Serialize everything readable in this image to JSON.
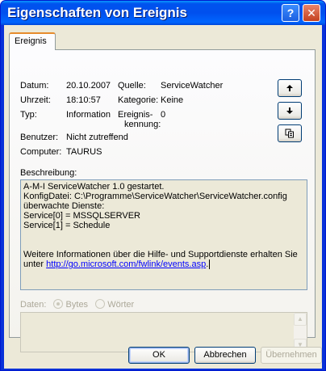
{
  "window": {
    "title": "Eigenschaften von Ereignis",
    "help_label": "?",
    "close_label": "✕"
  },
  "tab": {
    "label": "Ereignis"
  },
  "fields": {
    "datum_label": "Datum:",
    "datum_value": "20.10.2007",
    "quelle_label": "Quelle:",
    "quelle_value": "ServiceWatcher",
    "uhrzeit_label": "Uhrzeit:",
    "uhrzeit_value": "18:10:57",
    "kategorie_label": "Kategorie:",
    "kategorie_value": "Keine",
    "typ_label": "Typ:",
    "typ_value": "Information",
    "ereigniskennung_label_1": "Ereignis-",
    "ereigniskennung_label_2": "kennung:",
    "ereigniskennung_value": "0",
    "benutzer_label": "Benutzer:",
    "benutzer_value": "Nicht zutreffend",
    "computer_label": "Computer:",
    "computer_value": "TAURUS"
  },
  "side_buttons": {
    "up_icon": "arrow-up-icon",
    "down_icon": "arrow-down-icon",
    "copy_icon": "copy-icon"
  },
  "description": {
    "label": "Beschreibung:",
    "lines": [
      "A-M-I ServiceWatcher 1.0 gestartet.",
      "KonfigDatei: C:\\Programme\\ServiceWatcher\\ServiceWatcher.config",
      "überwachte Dienste:",
      "Service[0] = MSSQLSERVER",
      "Service[1] = Schedule",
      "",
      "",
      "Weitere Informationen über die Hilfe- und Supportdienste erhalten Sie"
    ],
    "link_prefix": "unter ",
    "link_text": "http://go.microsoft.com/fwlink/events.asp",
    "link_suffix": "."
  },
  "data_section": {
    "label": "Daten:",
    "option_bytes": "Bytes",
    "option_words": "Wörter",
    "selected": "Bytes"
  },
  "buttons": {
    "ok": "OK",
    "cancel": "Abbrechen",
    "apply": "Übernehmen"
  }
}
